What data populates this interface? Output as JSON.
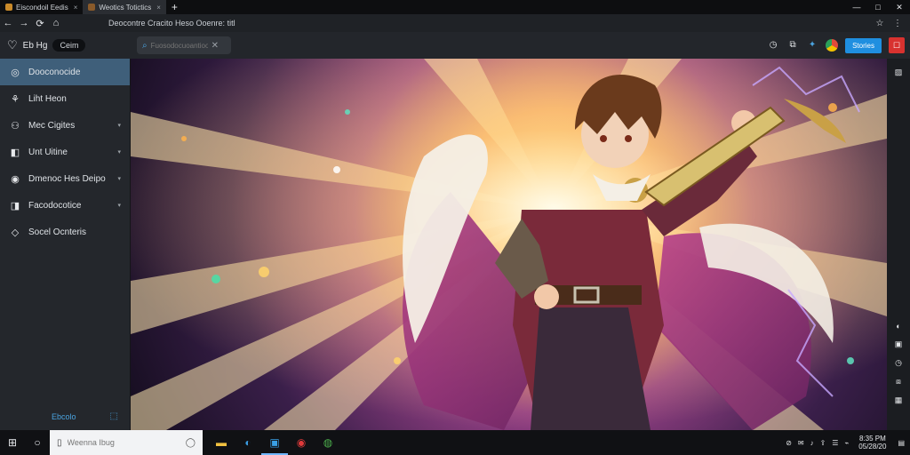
{
  "tabs": [
    {
      "label": "Eiscondoil Eedis",
      "close": "×"
    },
    {
      "label": "Weotics Totictics",
      "close": "×"
    }
  ],
  "new_tab": "+",
  "window_controls": {
    "minimize": "—",
    "maximize": "□",
    "close": "✕"
  },
  "nav": {
    "back": "←",
    "forward": "→",
    "reload": "⟳",
    "home": "⌂",
    "page_title": "Deocontre Cracito Heso Ooenre: titl",
    "star": "☆",
    "menu": "⋮"
  },
  "app": {
    "short": "Eb Hg",
    "pill": "Ceim"
  },
  "search": {
    "placeholder": "Fuosodocuoantioo",
    "clear": "✕"
  },
  "toolbar": {
    "primary_button": "Stories",
    "red_button": "☐"
  },
  "sidebar": {
    "items": [
      {
        "label": "Dooconocide",
        "icon": "coin-icon",
        "glyph": "◎",
        "active": true,
        "chev": ""
      },
      {
        "label": "Liht Heon",
        "icon": "grid-icon",
        "glyph": "⚘",
        "active": false,
        "chev": ""
      },
      {
        "label": "Mec Cigites",
        "icon": "people-icon",
        "glyph": "⚇",
        "active": false,
        "chev": "▾"
      },
      {
        "label": "Unt Uitine",
        "icon": "doc-icon",
        "glyph": "◧",
        "active": false,
        "chev": "▾"
      },
      {
        "label": "Dmenoc Hes Deipo",
        "icon": "camera-icon",
        "glyph": "◉",
        "active": false,
        "chev": "▾"
      },
      {
        "label": "Facodocotice",
        "icon": "bookmark-icon",
        "glyph": "◨",
        "active": false,
        "chev": "▾"
      },
      {
        "label": "Socel Ocnteris",
        "icon": "diamond-icon",
        "glyph": "◇",
        "active": false,
        "chev": ""
      }
    ],
    "footer_label": "Ebcolo",
    "footer_icon": "⬚"
  },
  "taskbar": {
    "start": "⊞",
    "cortana": "○",
    "search_placeholder": "Weenna Ibug",
    "apps": [
      {
        "name": "file-explorer-icon",
        "glyph": "▬",
        "color": "#f0c040"
      },
      {
        "name": "edge-icon",
        "glyph": "◐",
        "color": "#3a9be0"
      },
      {
        "name": "store-icon",
        "glyph": "▣",
        "color": "#3aa0e6"
      },
      {
        "name": "red-app-icon",
        "glyph": "◉",
        "color": "#e03a3a"
      },
      {
        "name": "chrome-icon",
        "glyph": "◍",
        "color": "#4cae4c"
      }
    ],
    "tray": [
      "⊘",
      "✉",
      "♪",
      "⇪",
      "☰",
      "⌁"
    ],
    "time": "8:35 PM",
    "date": "05/28/20",
    "notifications": "▤"
  },
  "colors": {
    "accent": "#1f8fe0",
    "sidebar_active": "#3f5f7a",
    "danger": "#d8322f"
  }
}
